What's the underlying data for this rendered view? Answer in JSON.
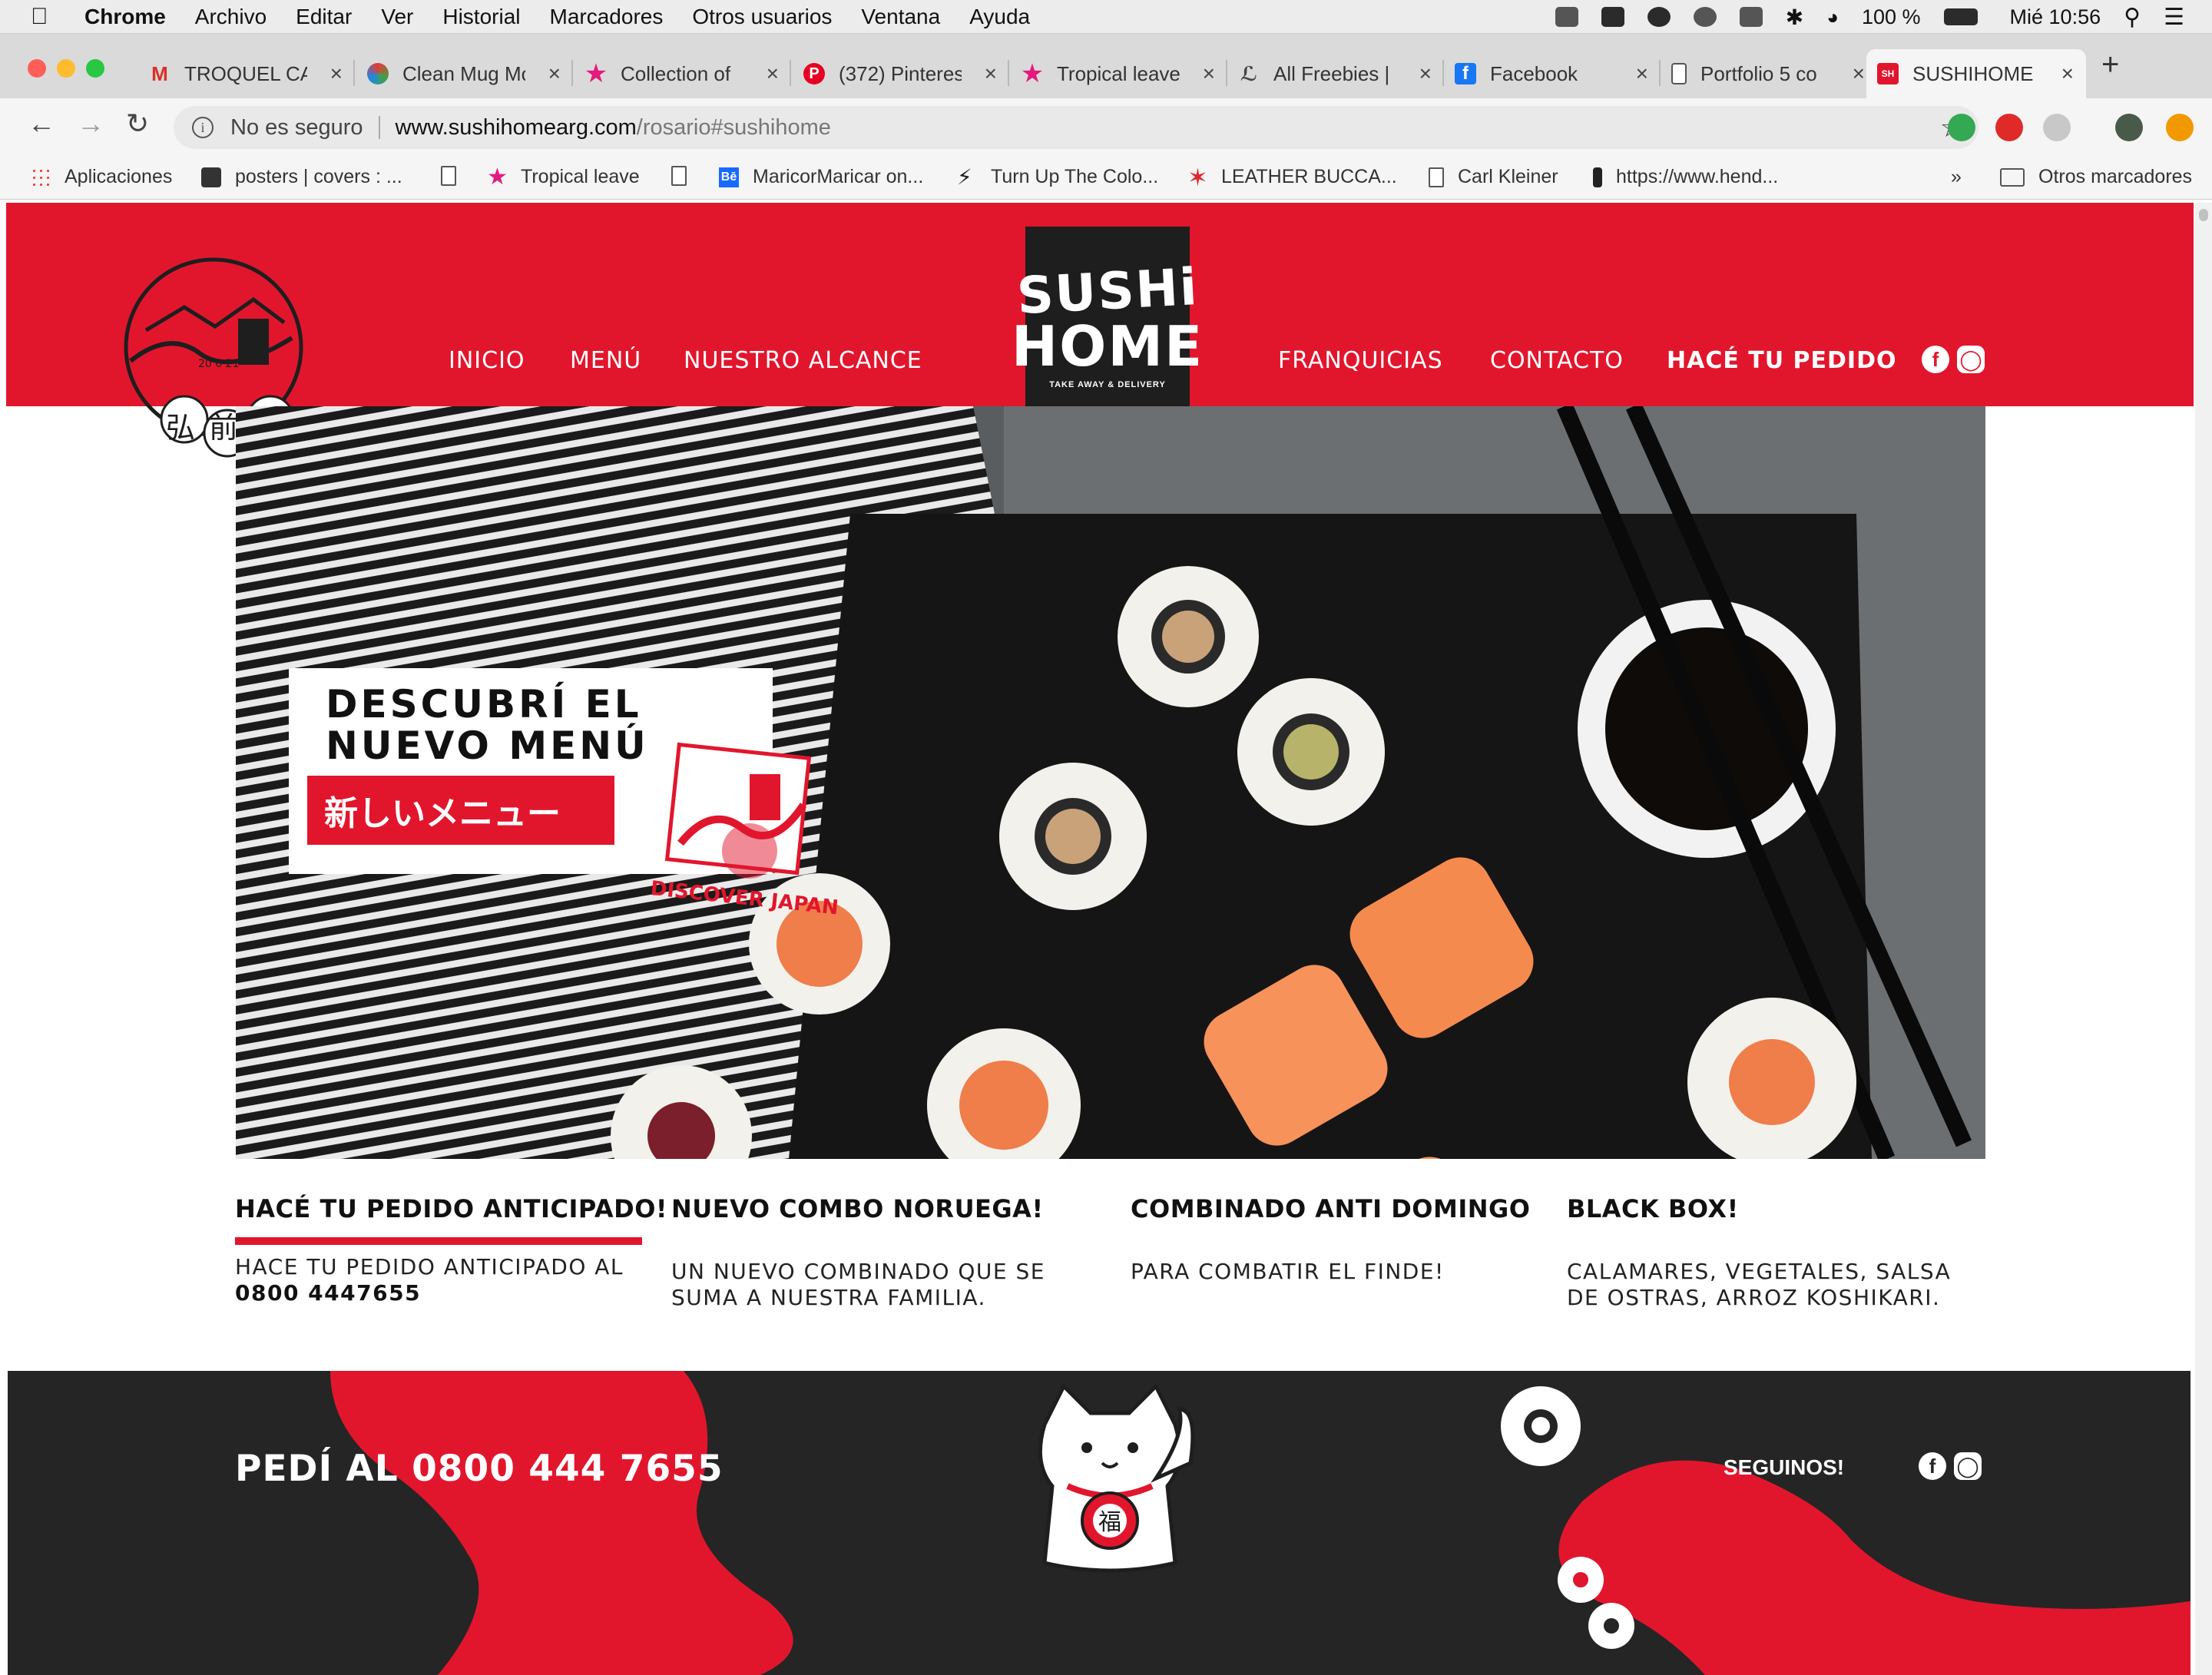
{
  "menubar": {
    "app": "Chrome",
    "items": [
      "Archivo",
      "Editar",
      "Ver",
      "Historial",
      "Marcadores",
      "Otros usuarios",
      "Ventana",
      "Ayuda"
    ],
    "battery": "100 %",
    "clock": "Mié 10:56"
  },
  "tabs": [
    {
      "title": "TROQUEL CA",
      "icon": "gmail-icon"
    },
    {
      "title": "Clean Mug Mo",
      "icon": "globe-icon"
    },
    {
      "title": "Collection of",
      "icon": "pink-star-icon"
    },
    {
      "title": "(372) Pinteres",
      "icon": "pinterest-icon"
    },
    {
      "title": "Tropical leave",
      "icon": "pink-star-icon"
    },
    {
      "title": "All Freebies |",
      "icon": "leaf-icon"
    },
    {
      "title": "Facebook",
      "icon": "facebook-icon"
    },
    {
      "title": "Portfolio 5 co",
      "icon": "document-icon"
    },
    {
      "title": "SUSHIHOME",
      "icon": "sushihome-icon"
    }
  ],
  "address": {
    "security": "No es seguro",
    "host": "www.sushihomearg.com",
    "path": "/rosario#sushihome"
  },
  "bookmarks": [
    {
      "label": "Aplicaciones",
      "icon": "apps-grid-icon"
    },
    {
      "label": "posters | covers : ...",
      "icon": "cube-icon"
    },
    {
      "label": "",
      "icon": "document-icon"
    },
    {
      "label": "Tropical leave",
      "icon": "pink-star-icon"
    },
    {
      "label": "",
      "icon": "document-icon"
    },
    {
      "label": "MaricorMaricar on...",
      "icon": "behance-icon"
    },
    {
      "label": "Turn Up The Colo...",
      "icon": "bolt-icon"
    },
    {
      "label": "LEATHER BUCCA...",
      "icon": "red-star-icon"
    },
    {
      "label": "Carl Kleiner",
      "icon": "document-icon"
    },
    {
      "label": "https://www.hend...",
      "icon": "bottle-icon"
    }
  ],
  "bookmarks_more": "»",
  "other_bookmarks": "Otros marcadores",
  "site": {
    "nav_left": [
      "INICIO",
      "MENÚ",
      "NUESTRO ALCANCE"
    ],
    "nav_right": [
      "FRANQUICIAS",
      "CONTACTO",
      "HACÉ TU PEDIDO"
    ],
    "logo_line1": "SUSHi",
    "logo_line2": "HOME",
    "logo_tagline": "TAKE AWAY & DELIVERY",
    "stamp_date": "20 6 21",
    "stamp_kanji": "弘前異",
    "hero_title": "DESCUBRÍ EL\nNUEVO MENÚ",
    "hero_jp": "新しいメニュー",
    "hero_stamp_text": "DISCOVER JAPAN",
    "news": [
      {
        "headline": "HACÉ TU PEDIDO ANTICIPADO!",
        "body": "HACE TU PEDIDO ANTICIPADO AL",
        "phone": "0800 4447655"
      },
      {
        "headline": "NUEVO COMBO NORUEGA!",
        "body": "UN NUEVO COMBINADO QUE SE SUMA A NUESTRA FAMILIA."
      },
      {
        "headline": "COMBINADO ANTI DOMINGO",
        "body": "PARA COMBATIR EL FINDE!"
      },
      {
        "headline": "BLACK BOX!",
        "body": "CALAMARES, VEGETALES, SALSA DE OSTRAS, ARROZ KOSHIKARI."
      }
    ],
    "footer_call": "PEDÍ AL 0800 444 7655",
    "footer_follow": "SEGUINOS!",
    "maneki_kanji": "福"
  },
  "colors": {
    "brand_red": "#e1162d",
    "dark": "#252525"
  }
}
